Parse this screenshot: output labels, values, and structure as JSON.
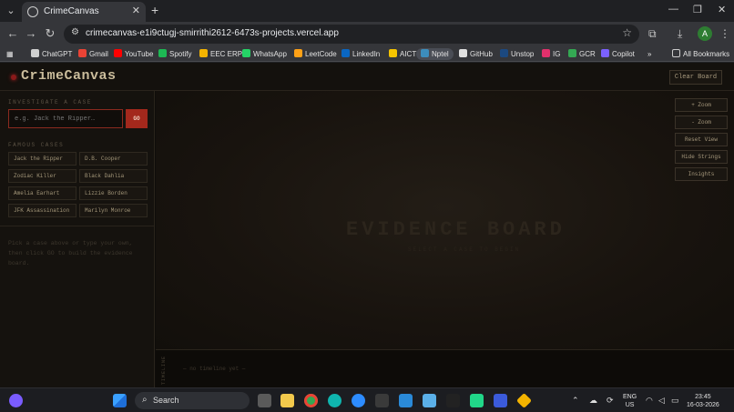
{
  "browser": {
    "tab_title": "CrimeCanvas",
    "url": "crimecanvas-e1i9ctugj-smirrithi2612-6473s-projects.vercel.app",
    "profile_initial": "A",
    "bookmarks": [
      {
        "label": "ChatGPT",
        "color": "#d0d0d0"
      },
      {
        "label": "Gmail",
        "color": "#ea4335"
      },
      {
        "label": "YouTube",
        "color": "#ff0000"
      },
      {
        "label": "Spotify",
        "color": "#1db954"
      },
      {
        "label": "EEC ERP",
        "color": "#f4b400"
      },
      {
        "label": "WhatsApp",
        "color": "#25d366"
      },
      {
        "label": "LeetCode",
        "color": "#ffa116"
      },
      {
        "label": "LinkedIn",
        "color": "#0a66c2"
      },
      {
        "label": "AICTE",
        "color": "#f5c400"
      },
      {
        "label": "Nptel",
        "color": "#3c8dbc"
      },
      {
        "label": "GitHub",
        "color": "#e0e0e0"
      },
      {
        "label": "Unstop",
        "color": "#1c4980"
      },
      {
        "label": "IG",
        "color": "#e1306c"
      },
      {
        "label": "GCR",
        "color": "#34a853"
      },
      {
        "label": "Copilot",
        "color": "#7b61ff"
      }
    ],
    "all_bookmarks": "All Bookmarks"
  },
  "app": {
    "logo": "CrimeCanvas",
    "clear_board": "Clear Board",
    "investigate_label": "INVESTIGATE A CASE",
    "search_placeholder": "e.g. Jack the Ripper…",
    "go": "GO",
    "famous_label": "FAMOUS CASES",
    "cases": [
      "Jack the Ripper",
      "D.B. Cooper",
      "Zodiac Killer",
      "Black Dahlia",
      "Amelia Earhart",
      "Lizzie Borden",
      "JFK Assassination",
      "Marilyn Monroe"
    ],
    "hint": "Pick a case above or type your own, then click GO to build the evidence board.",
    "board_title": "EVIDENCE BOARD",
    "board_subtitle": "SELECT A CASE TO BEGIN",
    "controls": [
      "+ Zoom",
      "- Zoom",
      "Reset View",
      "Hide Strings",
      "Insights"
    ],
    "timeline_label": "TIMELINE",
    "timeline_empty": "— no timeline yet —"
  },
  "taskbar": {
    "search": "Search",
    "lang_top": "ENG",
    "lang_bottom": "US",
    "time": "23:45",
    "date": "16-03-2026"
  }
}
